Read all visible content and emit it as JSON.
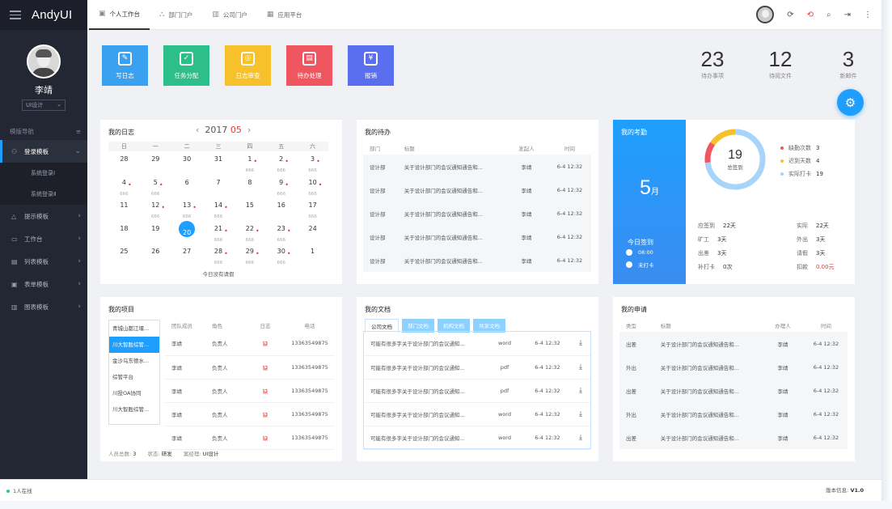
{
  "app": {
    "logo_prefix": "Andy",
    "logo_suffix": "UI"
  },
  "user": {
    "name": "李靖",
    "role": "UI设计"
  },
  "nav": {
    "header": "模版导航",
    "items": [
      {
        "label": "登录模板",
        "active": true
      },
      {
        "label": "提示模板"
      },
      {
        "label": "工作台"
      },
      {
        "label": "列表模板"
      },
      {
        "label": "表单模板"
      },
      {
        "label": "图表模板"
      }
    ],
    "subitems": [
      "系统登录Ⅰ",
      "系统登录Ⅱ"
    ]
  },
  "tabs": [
    "个人工作台",
    "部门门户",
    "公司门户",
    "应用平台"
  ],
  "shortcuts": [
    {
      "label": "写日志",
      "color": "#3aa0f0"
    },
    {
      "label": "任务分配",
      "color": "#2cbf8a"
    },
    {
      "label": "日志审查",
      "color": "#f7c12b"
    },
    {
      "label": "待办处理",
      "color": "#f0565f"
    },
    {
      "label": "报销",
      "color": "#5a6ef0"
    }
  ],
  "stats": [
    {
      "num": "23",
      "label": "待办事项"
    },
    {
      "num": "12",
      "label": "待阅文件"
    },
    {
      "num": "3",
      "label": "新邮件"
    }
  ],
  "diary": {
    "title": "我的日志",
    "year": "2017",
    "month": "05",
    "weekdays": [
      "日",
      "一",
      "二",
      "三",
      "四",
      "五",
      "六"
    ],
    "weeks": [
      [
        {
          "d": "28",
          "g": true
        },
        {
          "d": "29",
          "g": true
        },
        {
          "d": "30",
          "g": true
        },
        {
          "d": "31",
          "g": true
        },
        {
          "d": "1",
          "s": "666",
          "dot": true
        },
        {
          "d": "2",
          "s": "666",
          "dot": true
        },
        {
          "d": "3",
          "s": "666",
          "dot": true
        }
      ],
      [
        {
          "d": "4",
          "s": "666",
          "dot": true
        },
        {
          "d": "5",
          "s": "666",
          "dot": true
        },
        {
          "d": "6"
        },
        {
          "d": "7"
        },
        {
          "d": "8"
        },
        {
          "d": "9",
          "s": "666",
          "dot": true
        },
        {
          "d": "10",
          "s": "666",
          "dot": true
        }
      ],
      [
        {
          "d": "11"
        },
        {
          "d": "12",
          "s": "666",
          "dot": true
        },
        {
          "d": "13",
          "s": "666",
          "dot": true
        },
        {
          "d": "14",
          "s": "666",
          "dot": true
        },
        {
          "d": "15"
        },
        {
          "d": "16"
        },
        {
          "d": "17",
          "s": "666"
        }
      ],
      [
        {
          "d": "18"
        },
        {
          "d": "19"
        },
        {
          "d": "20",
          "today": true
        },
        {
          "d": "21",
          "s": "666",
          "dot": true
        },
        {
          "d": "22",
          "s": "666",
          "dot": true
        },
        {
          "d": "23",
          "s": "666",
          "dot": true
        },
        {
          "d": "24"
        }
      ],
      [
        {
          "d": "25"
        },
        {
          "d": "26"
        },
        {
          "d": "27"
        },
        {
          "d": "28",
          "s": "666",
          "dot": true
        },
        {
          "d": "29",
          "s": "666",
          "dot": true
        },
        {
          "d": "30",
          "s": "666",
          "dot": true
        },
        {
          "d": "1",
          "g": true
        }
      ]
    ],
    "note": "今日没有请假"
  },
  "todo": {
    "title": "我的待办",
    "headers": [
      "部门",
      "标题",
      "发起人",
      "时间"
    ],
    "rows": [
      [
        "设计部",
        "关于设计部门的会议通知通告和...",
        "李靖",
        "6-4 12:32"
      ],
      [
        "设计部",
        "关于设计部门的会议通知通告和...",
        "李靖",
        "6-4 12:32"
      ],
      [
        "设计部",
        "关于设计部门的会议通知通告和...",
        "李靖",
        "6-4 12:32"
      ],
      [
        "设计部",
        "关于设计部门的会议通知通告和...",
        "李靖",
        "6-4 12:32"
      ],
      [
        "设计部",
        "关于设计部门的会议通知通告和...",
        "李靖",
        "6-4 12:32"
      ]
    ]
  },
  "attendance": {
    "title": "我的考勤",
    "month_num": "5",
    "month_unit": "月",
    "checkin_label": "今日签到",
    "checkin_time": "08:00",
    "checkout_label": "未打卡",
    "total": "19",
    "total_label": "总签到",
    "legend": [
      {
        "label": "缺勤次数",
        "value": "3",
        "color": "#f0565f"
      },
      {
        "label": "迟到天数",
        "value": "4",
        "color": "#f7c12b"
      },
      {
        "label": "实际打卡",
        "value": "19",
        "color": "#a6d4fa"
      }
    ],
    "grid": [
      [
        "应签到",
        "22天",
        "实际",
        "22天"
      ],
      [
        "旷工",
        "3天",
        "外出",
        "3天"
      ],
      [
        "出差",
        "3天",
        "请假",
        "3天"
      ],
      [
        "补打卡",
        "0次",
        "扣款",
        "0.00元"
      ]
    ],
    "alert_color": "#e53935"
  },
  "projects": {
    "title": "我的项目",
    "list": [
      "青城山都江堰...",
      "川大智胜综管...",
      "金沙乌东德水...",
      "综管平台",
      "川投OA协同",
      "川大智胜综管..."
    ],
    "headers": [
      "团队成员",
      "角色",
      "日志",
      "电话"
    ],
    "rows": [
      [
        "李靖",
        "负责人",
        "缺",
        "13363549875"
      ],
      [
        "李靖",
        "负责人",
        "缺",
        "13363549875"
      ],
      [
        "李靖",
        "负责人",
        "缺",
        "13363549875"
      ],
      [
        "李靖",
        "负责人",
        "缺",
        "13363549875"
      ],
      [
        "李靖",
        "负责人",
        "缺",
        "13363549875"
      ]
    ],
    "footer": {
      "members_label": "人员总数:",
      "members": "3",
      "status_label": "状态:",
      "status": "研发",
      "manager_label": "案经理:",
      "manager": "UI设计"
    }
  },
  "docs": {
    "title": "我的文档",
    "tabs": [
      "公司文档",
      "部门文档",
      "机构文档",
      "共享文档"
    ],
    "rows": [
      [
        "可能有很多字关于设计部门的会议通知...",
        "word",
        "6-4 12:32"
      ],
      [
        "可能有很多字关于设计部门的会议通知...",
        "pdf",
        "6-4 12:32"
      ],
      [
        "可能有很多字关于设计部门的会议通知...",
        "pdf",
        "6-4 12:32"
      ],
      [
        "可能有很多字关于设计部门的会议通知...",
        "word",
        "6-4 12:32"
      ],
      [
        "可能有很多字关于设计部门的会议通知...",
        "word",
        "6-4 12:32"
      ]
    ]
  },
  "apply": {
    "title": "我的申请",
    "headers": [
      "类型",
      "标题",
      "办理人",
      "时间"
    ],
    "rows": [
      [
        "出差",
        "关于设计部门的会议通知通告和...",
        "李靖",
        "6-4 12:32"
      ],
      [
        "外出",
        "关于设计部门的会议通知通告和...",
        "李靖",
        "6-4 12:32"
      ],
      [
        "出差",
        "关于设计部门的会议通知通告和...",
        "李靖",
        "6-4 12:32"
      ],
      [
        "外出",
        "关于设计部门的会议通知通告和...",
        "李靖",
        "6-4 12:32"
      ],
      [
        "出差",
        "关于设计部门的会议通知通告和...",
        "李靖",
        "6-4 12:32"
      ]
    ]
  },
  "footer": {
    "online": "1人在线",
    "version_label": "版本信息:",
    "version": "V1.0"
  }
}
